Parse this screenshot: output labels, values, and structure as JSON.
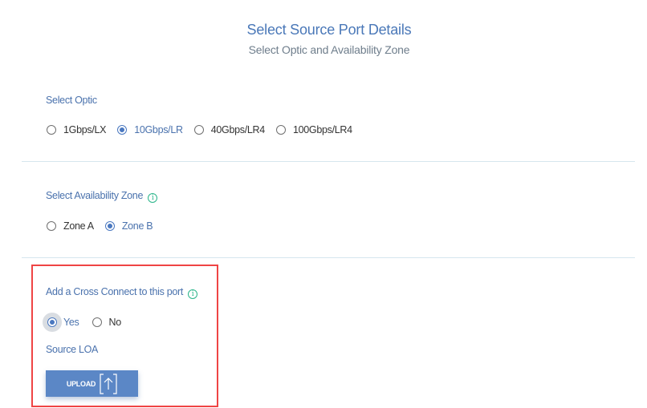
{
  "header": {
    "title": "Select Source Port Details",
    "subtitle": "Select Optic and Availability Zone"
  },
  "optic": {
    "label": "Select Optic",
    "options": [
      {
        "label": "1Gbps/LX",
        "checked": false
      },
      {
        "label": "10Gbps/LR",
        "checked": true
      },
      {
        "label": "40Gbps/LR4",
        "checked": false
      },
      {
        "label": "100Gbps/LR4",
        "checked": false
      }
    ]
  },
  "zone": {
    "label": "Select Availability Zone",
    "info_icon": "info-icon",
    "options": [
      {
        "label": "Zone A",
        "checked": false
      },
      {
        "label": "Zone B",
        "checked": true
      }
    ]
  },
  "cross_connect": {
    "label": "Add a Cross Connect to this port",
    "info_icon": "info-icon",
    "options": [
      {
        "label": "Yes",
        "checked": true
      },
      {
        "label": "No",
        "checked": false
      }
    ]
  },
  "source_loa": {
    "label": "Source LOA",
    "upload_label": "UPLOAD",
    "upload_icon": "upload-arrow-icon"
  },
  "colors": {
    "accent": "#4a78c0",
    "title": "#4a78b8",
    "button": "#5b87c6",
    "info": "#2bb58a",
    "highlight": "#ef4444",
    "divider": "#d6e6ee"
  }
}
